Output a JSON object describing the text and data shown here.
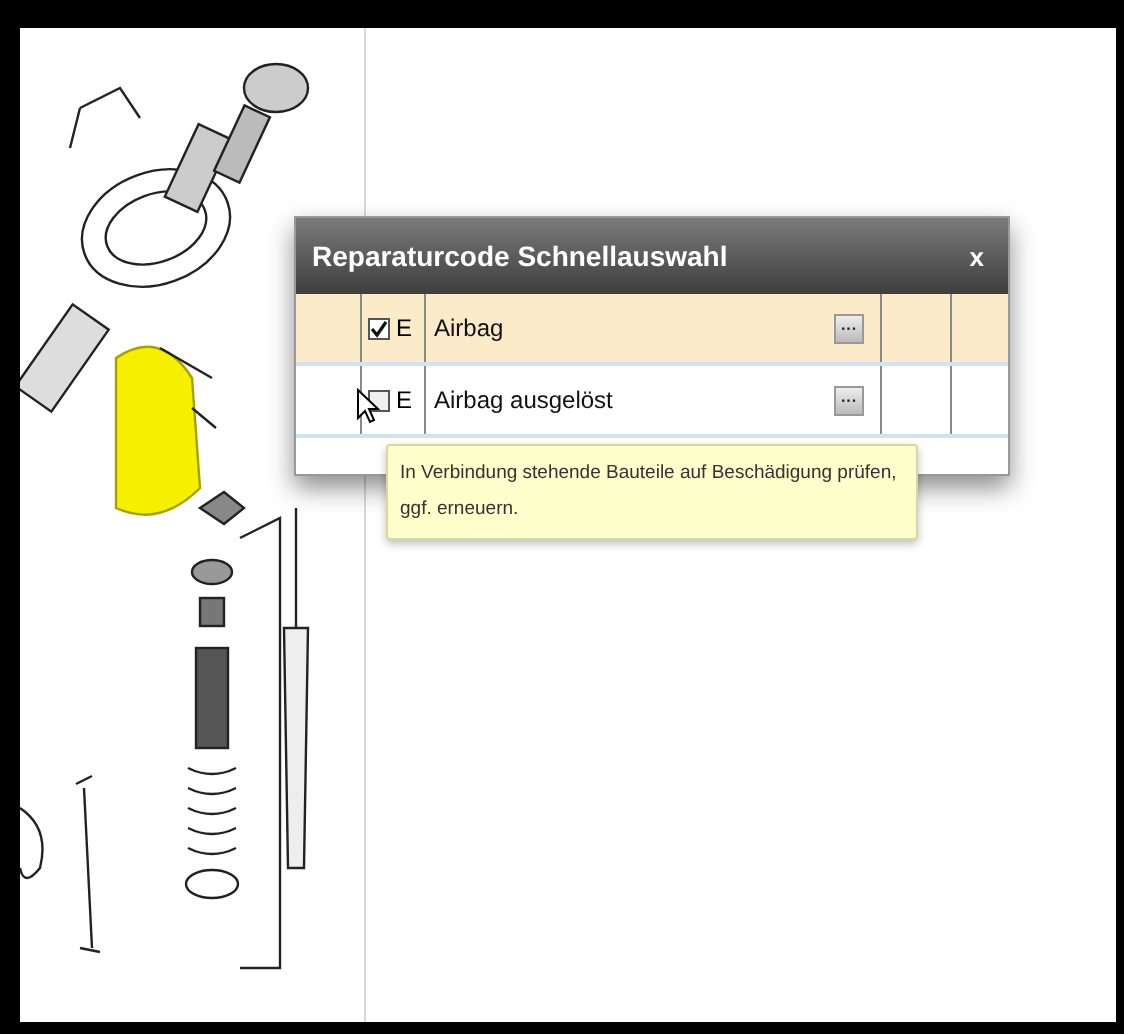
{
  "dialog": {
    "title": "Reparaturcode Schnellauswahl",
    "close": "x",
    "rows": [
      {
        "checked": true,
        "code": "E",
        "label": "Airbag",
        "more": "···",
        "selected": true
      },
      {
        "checked": false,
        "code": "E",
        "label": "Airbag ausgelöst",
        "more": "···",
        "selected": false
      }
    ]
  },
  "tooltip": {
    "text": "In Verbindung stehende Bauteile auf Beschädigung prüfen, ggf. erneuern."
  }
}
